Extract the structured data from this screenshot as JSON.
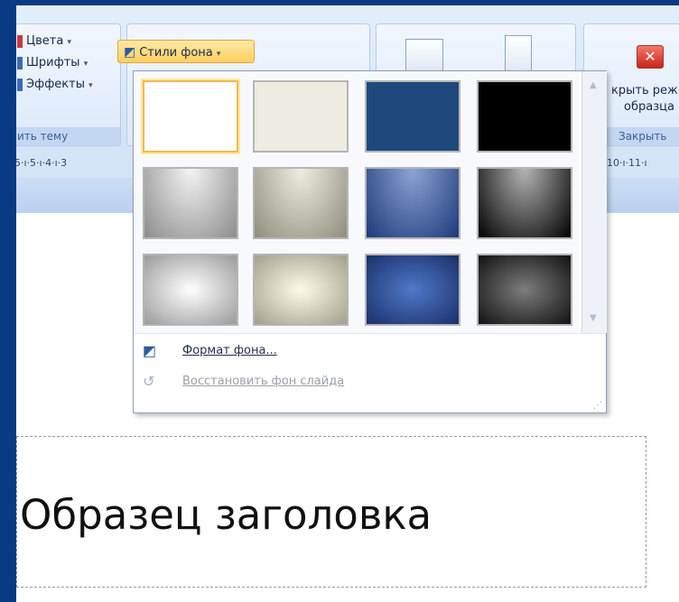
{
  "ribbon": {
    "theme_items": [
      {
        "label": "Цвета",
        "icon": "colors-icon",
        "color": "#d0383a"
      },
      {
        "label": "Шрифты",
        "icon": "fonts-icon",
        "color": "#3b6bb5"
      },
      {
        "label": "Эффекты",
        "icon": "effects-icon",
        "color": "#3b6bb5"
      }
    ],
    "theme_group_label": "ить тему",
    "background_styles_label": "Стили фона",
    "close_group": {
      "line1": "крыть реж",
      "line2": "образца",
      "label": "Закрыть"
    }
  },
  "ruler": {
    "left_ticks": "5·ı·5·ı·4·ı·3",
    "right_ticks": "10·ı·11·ı"
  },
  "background_styles_menu": {
    "thumbnails": [
      {
        "row": 1,
        "col": 1,
        "style": "solid white",
        "selected": true,
        "color1": "#ffffff",
        "color2": "#ffffff"
      },
      {
        "row": 1,
        "col": 2,
        "style": "solid light beige",
        "selected": false,
        "color1": "#eeece1",
        "color2": "#eeece1"
      },
      {
        "row": 1,
        "col": 3,
        "style": "solid dark blue",
        "selected": false,
        "color1": "#1f497d",
        "color2": "#1f497d"
      },
      {
        "row": 1,
        "col": 4,
        "style": "solid black",
        "selected": false,
        "color1": "#000000",
        "color2": "#000000"
      },
      {
        "row": 2,
        "col": 1,
        "style": "gradient gray",
        "selected": false,
        "color1": "#f4f4f4",
        "color2": "#8c8c8c"
      },
      {
        "row": 2,
        "col": 2,
        "style": "gradient beige",
        "selected": false,
        "color1": "#f0eee2",
        "color2": "#8f8d7c"
      },
      {
        "row": 2,
        "col": 3,
        "style": "gradient blue",
        "selected": false,
        "color1": "#8ea4d6",
        "color2": "#1d3a7a"
      },
      {
        "row": 2,
        "col": 4,
        "style": "gradient black",
        "selected": false,
        "color1": "#b5b5b5",
        "color2": "#000000"
      },
      {
        "row": 3,
        "col": 1,
        "style": "radial gray",
        "selected": false,
        "color1": "#ffffff",
        "color2": "#9a9a9a"
      },
      {
        "row": 3,
        "col": 2,
        "style": "radial beige",
        "selected": false,
        "color1": "#fffbea",
        "color2": "#a19f8c"
      },
      {
        "row": 3,
        "col": 3,
        "style": "radial blue",
        "selected": false,
        "color1": "#4f79c8",
        "color2": "#1a2f6a"
      },
      {
        "row": 3,
        "col": 4,
        "style": "radial black",
        "selected": false,
        "color1": "#7d7d7d",
        "color2": "#111111"
      }
    ],
    "format_background_label": "Формат фона...",
    "reset_background_label": "Восстановить фон слайда"
  },
  "slide": {
    "title_text": "Образец заголовка"
  }
}
